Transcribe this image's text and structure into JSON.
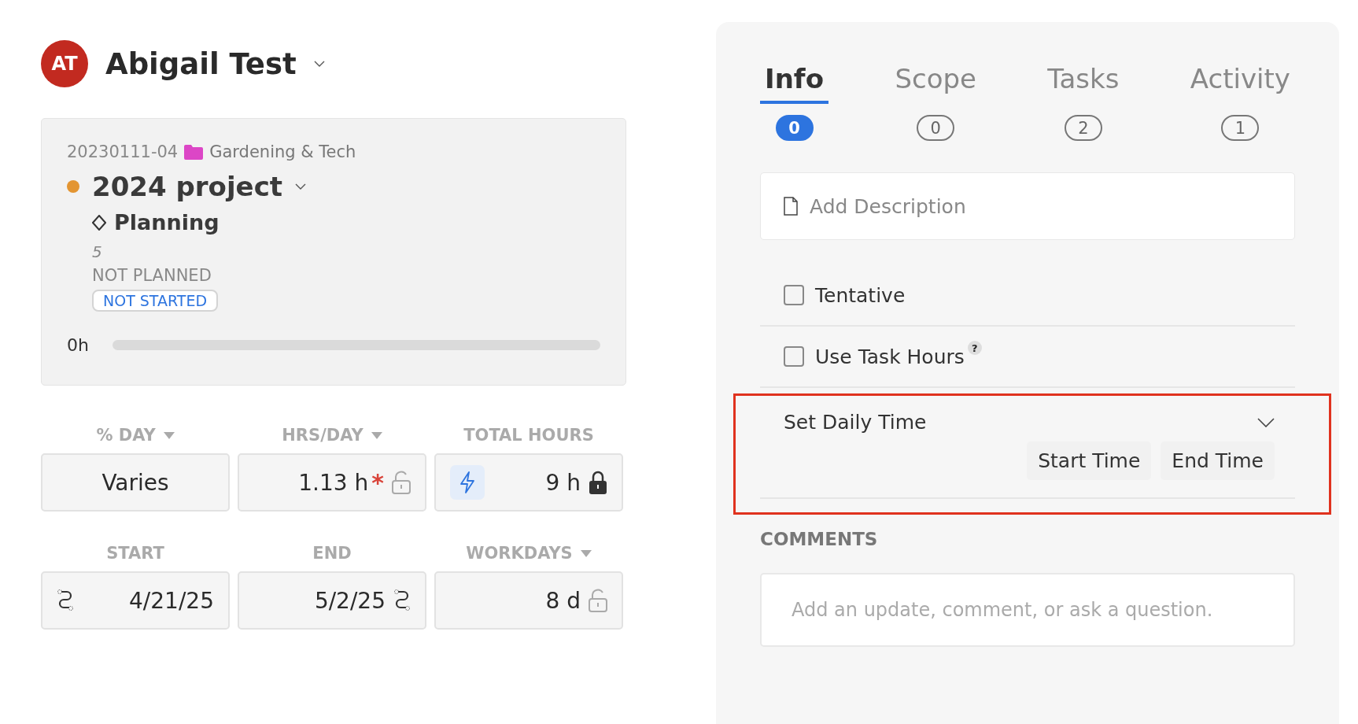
{
  "user": {
    "initials": "AT",
    "name": "Abigail Test"
  },
  "project_card": {
    "code": "20230111-04",
    "folder": "Gardening & Tech",
    "title": "2024 project",
    "phase": "Planning",
    "number": "5",
    "plan_status": "NOT PLANNED",
    "badge": "NOT STARTED",
    "hours": "0h",
    "level": 0
  },
  "fields": [
    {
      "label": "% DAY",
      "dropdown": true,
      "value": "Varies",
      "lockable": false,
      "kind": "plain"
    },
    {
      "label": "HRS/DAY",
      "dropdown": true,
      "value": "1.13 h",
      "required_mark": "*",
      "lockable": true,
      "locked": false,
      "kind": "plain"
    },
    {
      "label": "TOTAL HOURS",
      "dropdown": false,
      "value": "9 h",
      "lockable": true,
      "locked": true,
      "kind": "auto"
    },
    {
      "label": "START",
      "dropdown": false,
      "value": "4/21/25",
      "lockable": false,
      "kind": "link_start"
    },
    {
      "label": "END",
      "dropdown": false,
      "value": "5/2/25",
      "lockable": false,
      "kind": "link_end"
    },
    {
      "label": "WORKDAYS",
      "dropdown": true,
      "value": "8 d",
      "lockable": true,
      "locked": false,
      "kind": "plain"
    }
  ],
  "tabs": [
    {
      "label": "Info",
      "count": "0",
      "selected": true
    },
    {
      "label": "Scope",
      "count": "0",
      "selected": false
    },
    {
      "label": "Tasks",
      "count": "2",
      "selected": false
    },
    {
      "label": "Activity",
      "count": "1",
      "selected": false
    }
  ],
  "description": {
    "placeholder": "Add Description"
  },
  "checks": [
    {
      "label": "Tentative",
      "checked": false
    },
    {
      "label": "Use Task Hours",
      "checked": false,
      "help_mark": "?"
    }
  ],
  "daily_time": {
    "label": "Set Daily Time",
    "buttons": [
      "Start Time",
      "End Time"
    ]
  },
  "comments": {
    "heading": "COMMENTS",
    "placeholder": "Add an update, comment, or ask a question."
  }
}
